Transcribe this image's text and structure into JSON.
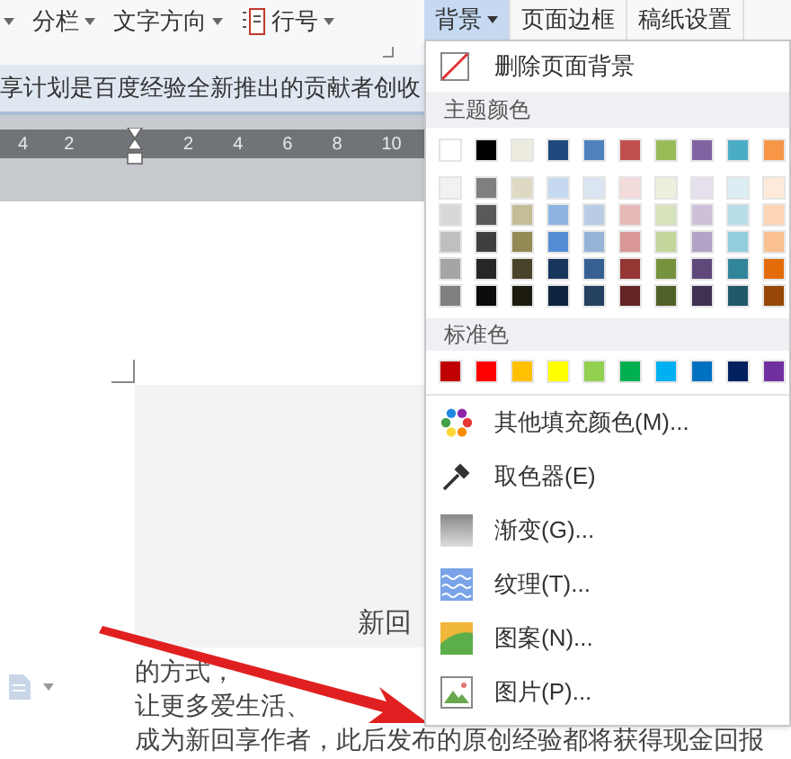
{
  "toolbar": {
    "items": [
      {
        "label": "分栏",
        "icon": false
      },
      {
        "label": "文字方向",
        "icon": false
      },
      {
        "label": "行号",
        "icon": true
      }
    ]
  },
  "doc_strip": {
    "text": "享计划是百度经验全新推出的贡献者创收"
  },
  "ruler": {
    "left_ticks": [
      "4",
      "2"
    ],
    "right_ticks": [
      "2",
      "4",
      "6",
      "8",
      "10"
    ]
  },
  "document": {
    "box_text": "新回",
    "lines": [
      "的方式，",
      "让更多爱生活、",
      "成为新回享作者，此后发布的原创经验都将获得现金回报"
    ]
  },
  "tabs": [
    {
      "label": "背景",
      "selected": true,
      "caret": true
    },
    {
      "label": "页面边框",
      "selected": false,
      "caret": false
    },
    {
      "label": "稿纸设置",
      "selected": false,
      "caret": false
    }
  ],
  "menu": {
    "delete_item": "删除页面背景",
    "theme_header": "主题颜色",
    "theme_colors": [
      {
        "color": "#ffffff"
      },
      {
        "color": "#000000"
      },
      {
        "color": "#eeece1"
      },
      {
        "color": "#1f497d"
      },
      {
        "color": "#4f81bd"
      },
      {
        "color": "#c0504d"
      },
      {
        "color": "#9bbb59"
      },
      {
        "color": "#8064a2"
      },
      {
        "color": "#4bacc6"
      },
      {
        "color": "#f79646"
      }
    ],
    "shades": [
      [
        {
          "color": "#f2f2f2"
        },
        {
          "color": "#7f7f7f"
        },
        {
          "color": "#ddd9c3"
        },
        {
          "color": "#c6d9f0"
        },
        {
          "color": "#dbe5f1"
        },
        {
          "color": "#f2dcdb"
        },
        {
          "color": "#ebf1dd"
        },
        {
          "color": "#e5e0ec"
        },
        {
          "color": "#dbeef3"
        },
        {
          "color": "#fdeada"
        }
      ],
      [
        {
          "color": "#d8d8d8"
        },
        {
          "color": "#595959"
        },
        {
          "color": "#c4bd97"
        },
        {
          "color": "#8db3e2"
        },
        {
          "color": "#b8cce4"
        },
        {
          "color": "#e5b9b7"
        },
        {
          "color": "#d7e3bc"
        },
        {
          "color": "#ccc1d9"
        },
        {
          "color": "#b7dde8"
        },
        {
          "color": "#fbd5b5"
        }
      ],
      [
        {
          "color": "#bfbfbf"
        },
        {
          "color": "#3f3f3f"
        },
        {
          "color": "#938953"
        },
        {
          "color": "#548dd4"
        },
        {
          "color": "#95b3d7"
        },
        {
          "color": "#d99694"
        },
        {
          "color": "#c3d69b"
        },
        {
          "color": "#b2a2c7"
        },
        {
          "color": "#92cddc"
        },
        {
          "color": "#fac08f"
        }
      ],
      [
        {
          "color": "#a5a5a5"
        },
        {
          "color": "#262626"
        },
        {
          "color": "#494429"
        },
        {
          "color": "#17365d"
        },
        {
          "color": "#366092"
        },
        {
          "color": "#953734"
        },
        {
          "color": "#76923c"
        },
        {
          "color": "#5f497a"
        },
        {
          "color": "#31859b"
        },
        {
          "color": "#e36c09"
        }
      ],
      [
        {
          "color": "#7f7f7f"
        },
        {
          "color": "#0c0c0c"
        },
        {
          "color": "#1d1b10"
        },
        {
          "color": "#0f243e"
        },
        {
          "color": "#244061"
        },
        {
          "color": "#632423"
        },
        {
          "color": "#4f6128"
        },
        {
          "color": "#3f3151"
        },
        {
          "color": "#205867"
        },
        {
          "color": "#974806"
        }
      ]
    ],
    "standard_header": "标准色",
    "standard_colors": [
      {
        "color": "#c00000"
      },
      {
        "color": "#ff0000"
      },
      {
        "color": "#ffc000"
      },
      {
        "color": "#ffff00"
      },
      {
        "color": "#92d050"
      },
      {
        "color": "#00b050"
      },
      {
        "color": "#00b0f0"
      },
      {
        "color": "#0070c0"
      },
      {
        "color": "#002060"
      },
      {
        "color": "#7030a0"
      }
    ],
    "items": [
      {
        "kind": "colors",
        "label": "其他填充颜色(M)..."
      },
      {
        "kind": "picker",
        "label": "取色器(E)"
      },
      {
        "kind": "gradient",
        "label": "渐变(G)..."
      },
      {
        "kind": "texture",
        "label": "纹理(T)..."
      },
      {
        "kind": "pattern",
        "label": "图案(N)..."
      },
      {
        "kind": "picture",
        "label": "图片(P)..."
      }
    ]
  }
}
